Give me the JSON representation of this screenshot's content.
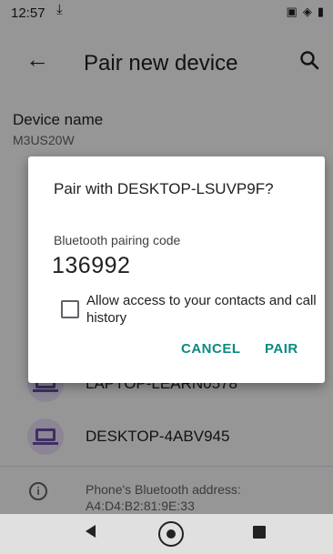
{
  "status_bar": {
    "time": "12:57",
    "download_icon": "download-arrow-icon",
    "icons": [
      "notification-icon",
      "vibrate-icon",
      "battery-icon"
    ]
  },
  "toolbar": {
    "back_icon": "back-arrow-icon",
    "title": "Pair new device",
    "search_icon": "search-icon"
  },
  "device_name": {
    "label": "Device name",
    "value": "M3US20W"
  },
  "devices": [
    {
      "label": "LAPTOP-LEARN0578",
      "icon": "laptop-icon"
    },
    {
      "label": "DESKTOP-4ABV945",
      "icon": "laptop-icon"
    }
  ],
  "bt_info": {
    "icon": "info-icon",
    "address_label": "Phone's Bluetooth address:",
    "address_value": "A4:D4:B2:81:9E:33"
  },
  "dialog": {
    "title": "Pair with DESKTOP-LSUVP9F?",
    "code_label": "Bluetooth pairing code",
    "code": "136992",
    "checkbox_label": "Allow access to your contacts and call history",
    "checkbox_checked": false,
    "cancel_label": "CANCEL",
    "pair_label": "PAIR",
    "accent_color": "#0b8a7f"
  },
  "nav_bar": {
    "back_icon": "nav-back-icon",
    "home_icon": "nav-home-icon",
    "recent_icon": "nav-recents-icon"
  }
}
